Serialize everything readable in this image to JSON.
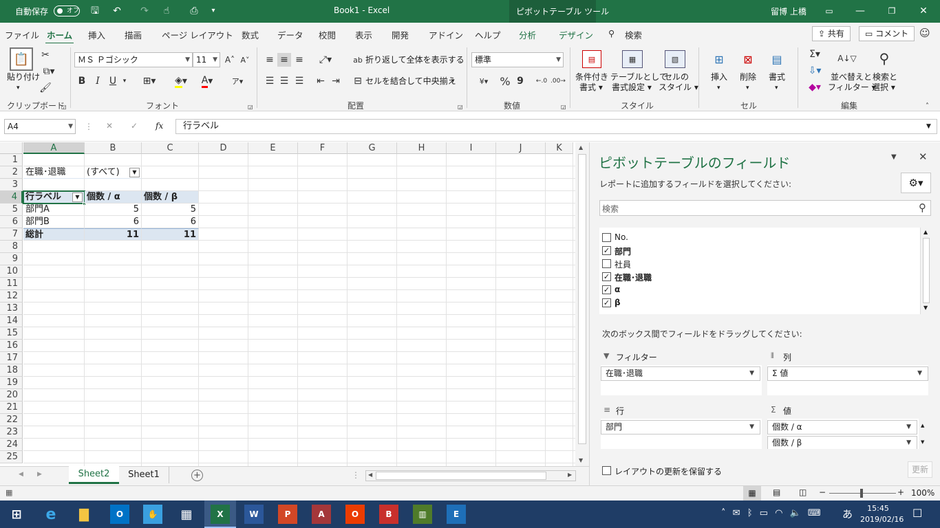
{
  "titlebar": {
    "autosave_label": "自動保存",
    "autosave_state": "オフ",
    "doc_title": "Book1  -  Excel",
    "context_title": "ピボットテーブル ツール",
    "user": "留博 上橋"
  },
  "menu": {
    "tabs": [
      "ファイル",
      "ホーム",
      "挿入",
      "描画",
      "ページ レイアウト",
      "数式",
      "データ",
      "校閲",
      "表示",
      "開発",
      "アドイン",
      "ヘルプ",
      "分析",
      "デザイン"
    ],
    "search": "検索",
    "share": "共有",
    "comment": "コメント"
  },
  "ribbon": {
    "clipboard": {
      "paste": "貼り付け",
      "label": "クリップボード"
    },
    "font": {
      "name": "ＭＳ Ｐゴシック",
      "size": "11",
      "bold": "B",
      "italic": "I",
      "underline": "U",
      "label": "フォント"
    },
    "alignment": {
      "wrap": "折り返して全体を表示する",
      "merge": "セルを結合して中央揃え",
      "label": "配置"
    },
    "number": {
      "format": "標準",
      "percent": "%",
      "comma": "9",
      "label": "数値"
    },
    "styles": {
      "conditional": [
        "条件付き",
        "書式"
      ],
      "table": [
        "テーブルとして",
        "書式設定"
      ],
      "cellstyle": [
        "セルの",
        "スタイル"
      ],
      "label": "スタイル"
    },
    "cells": {
      "insert": "挿入",
      "delete": "削除",
      "format": "書式",
      "label": "セル"
    },
    "editing": {
      "sort": [
        "並べ替えと",
        "フィルター"
      ],
      "find": [
        "検索と",
        "選択"
      ],
      "label": "編集"
    }
  },
  "formula_bar": {
    "name_box": "A4",
    "fx": "fx",
    "content": "行ラベル"
  },
  "sheet": {
    "columns": [
      "A",
      "B",
      "C",
      "D",
      "E",
      "F",
      "G",
      "H",
      "I",
      "J",
      "K"
    ],
    "rows": [
      "1",
      "2",
      "3",
      "4",
      "5",
      "6",
      "7",
      "8",
      "9",
      "10",
      "11",
      "12",
      "13",
      "14",
      "15",
      "16",
      "17",
      "18",
      "19",
      "20",
      "21",
      "22",
      "23",
      "24",
      "25"
    ],
    "filter_label": "在職･退職",
    "filter_value": "(すべて)",
    "header": [
      "行ラベル",
      "個数 / α",
      "個数 / β"
    ],
    "data": [
      [
        "部門A",
        "5",
        "5"
      ],
      [
        "部門B",
        "6",
        "6"
      ]
    ],
    "total": [
      "総計",
      "11",
      "11"
    ]
  },
  "tabs": [
    "Sheet2",
    "Sheet1"
  ],
  "pivot_pane": {
    "title": "ピボットテーブルのフィールド",
    "subtitle": "レポートに追加するフィールドを選択してください:",
    "search_placeholder": "検索",
    "fields": [
      {
        "name": "No.",
        "checked": false
      },
      {
        "name": "部門",
        "checked": true
      },
      {
        "name": "社員",
        "checked": false
      },
      {
        "name": "在職･退職",
        "checked": true
      },
      {
        "name": "α",
        "checked": true
      },
      {
        "name": "β",
        "checked": true
      }
    ],
    "drag_hint": "次のボックス間でフィールドをドラッグしてください:",
    "filter_label": "フィルター",
    "columns_label": "列",
    "rows_label": "行",
    "values_label": "値",
    "filter_item": "在職･退職",
    "columns_item": "Σ 値",
    "rows_item": "部門",
    "values_items": [
      "個数 / α",
      "個数 / β"
    ],
    "defer_label": "レイアウトの更新を保留する",
    "update_button": "更新"
  },
  "status": {
    "zoom": "100%"
  },
  "taskbar": {
    "time": "15:45",
    "date": "2019/02/16",
    "ime": "あ"
  },
  "colors": {
    "excel_green": "#217346",
    "pivot_header": "#dce6f1",
    "taskbar": "#1f3d66"
  }
}
